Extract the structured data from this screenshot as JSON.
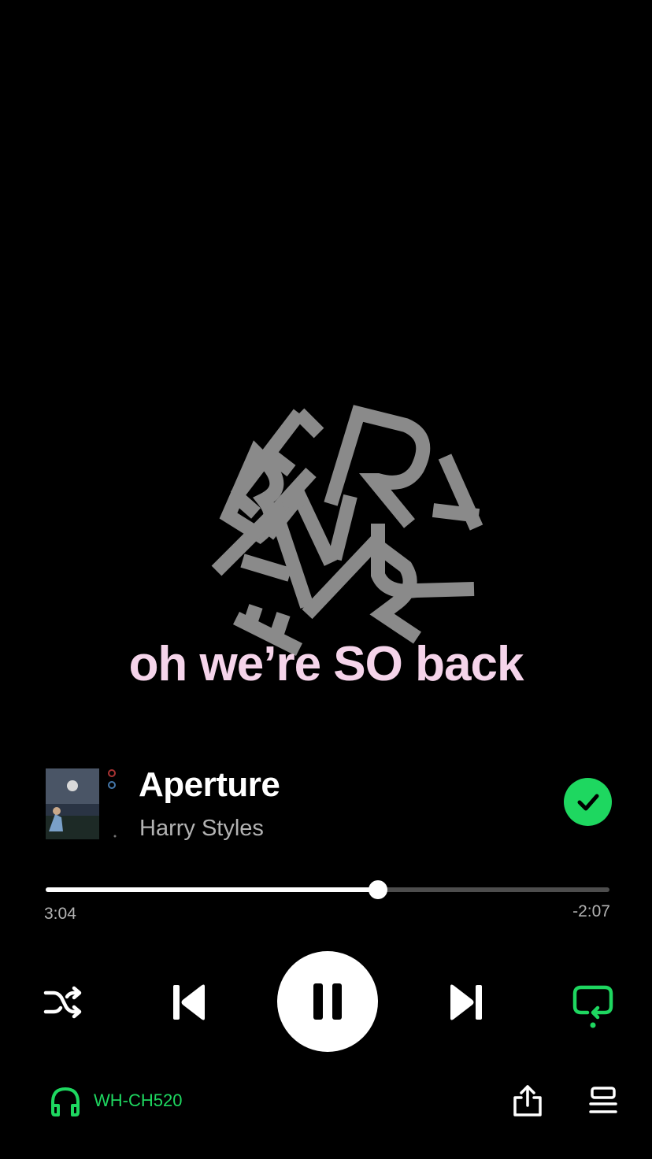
{
  "colors": {
    "accent": "#1ed760",
    "caption": "#f5d4ea",
    "background": "#000000",
    "muted": "#b3b3b3"
  },
  "artwork": {
    "icon": "album-title-typography-art"
  },
  "caption": "oh we’re SO back",
  "track": {
    "title": "Aperture",
    "artist": "Harry Styles",
    "liked": true,
    "liked_icon": "checkmark-icon"
  },
  "playback": {
    "elapsed": "3:04",
    "remaining": "-2:07",
    "progress": 0.59,
    "state": "playing"
  },
  "controls": {
    "shuffle_icon": "shuffle-icon",
    "previous_icon": "skip-previous-icon",
    "pause_icon": "pause-icon",
    "next_icon": "skip-next-icon",
    "repeat_icon": "repeat-icon"
  },
  "bottom_bar": {
    "device_name": "WH-CH520",
    "device_icon": "headphones-icon",
    "share_icon": "share-icon",
    "queue_icon": "queue-icon"
  }
}
